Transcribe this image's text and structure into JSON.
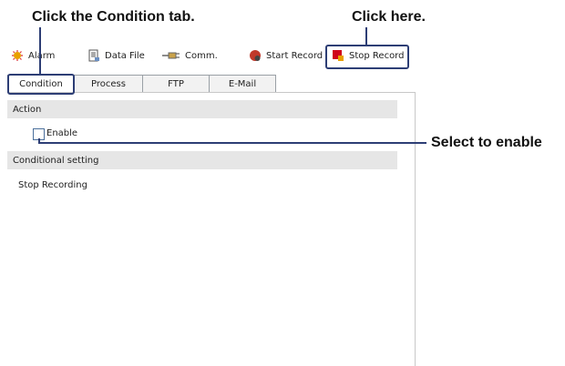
{
  "annotations": {
    "condition_tab": "Click the Condition tab.",
    "click_here": "Click here.",
    "select_enable": "Select to enable"
  },
  "toolbar": {
    "alarm": "Alarm",
    "data_file": "Data File",
    "comm": "Comm.",
    "start_record": "Start Record",
    "stop_record": "Stop Record"
  },
  "tabs": [
    "Condition",
    "Process",
    "FTP",
    "E-Mail"
  ],
  "panel": {
    "action_header": "Action",
    "enable_label": "Enable",
    "conditional_header": "Conditional setting",
    "stop_recording": "Stop Recording"
  },
  "colors": {
    "highlight": "#2d3e75",
    "section_bg": "#e6e6e6"
  },
  "icons": [
    "alarm-icon",
    "data-file-icon",
    "comm-icon",
    "start-record-icon",
    "stop-record-icon"
  ]
}
